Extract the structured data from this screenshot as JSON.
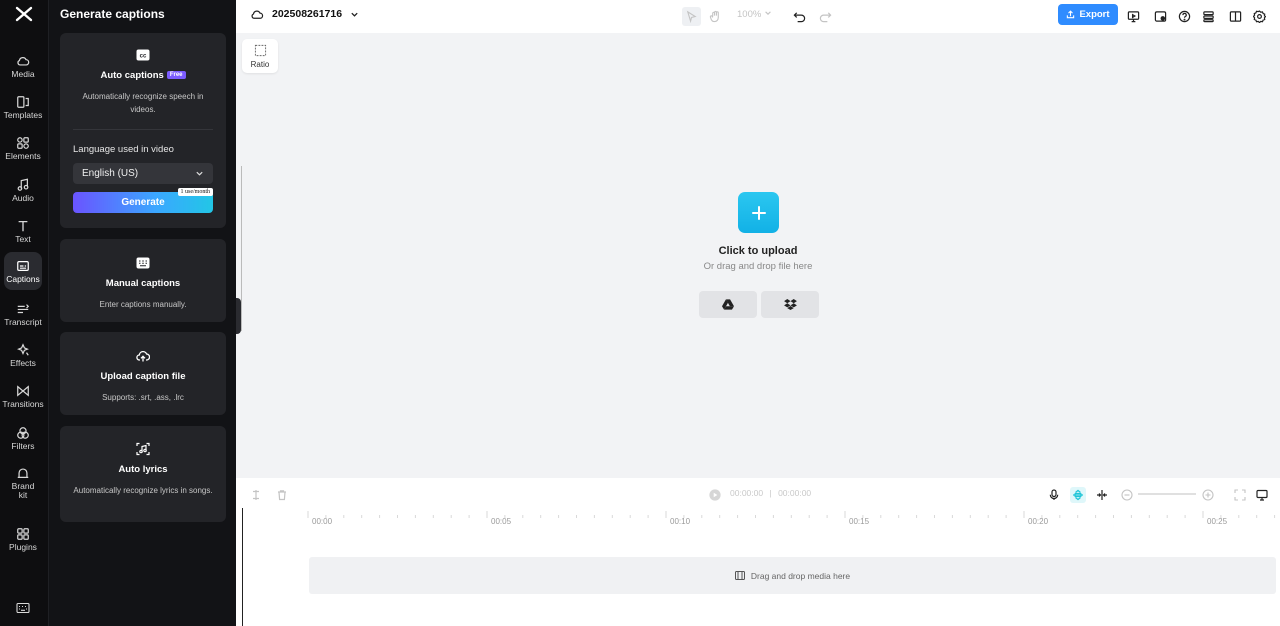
{
  "panel": {
    "title": "Generate captions",
    "auto_captions": {
      "title": "Auto captions",
      "badge": "Free",
      "description": "Automatically recognize speech in videos.",
      "language_label": "Language used in video",
      "language_value": "English (US)",
      "generate_label": "Generate",
      "quota_tag": "1 use/month"
    },
    "manual_captions": {
      "title": "Manual captions",
      "description": "Enter captions manually."
    },
    "upload_caption_file": {
      "title": "Upload caption file",
      "description": "Supports: .srt, .ass, .lrc"
    },
    "auto_lyrics": {
      "title": "Auto lyrics",
      "description": "Automatically recognize lyrics in songs."
    }
  },
  "rail": {
    "items": [
      {
        "label": "Media",
        "icon": "cloud-icon"
      },
      {
        "label": "Templates",
        "icon": "templates-icon"
      },
      {
        "label": "Elements",
        "icon": "elements-icon"
      },
      {
        "label": "Audio",
        "icon": "music-note-icon"
      },
      {
        "label": "Text",
        "icon": "text-icon"
      },
      {
        "label": "Captions",
        "icon": "captions-icon",
        "active": true
      },
      {
        "label": "Transcript",
        "icon": "transcript-icon"
      },
      {
        "label": "Effects",
        "icon": "effects-icon"
      },
      {
        "label": "Transitions",
        "icon": "transitions-icon"
      },
      {
        "label": "Filters",
        "icon": "filters-icon"
      },
      {
        "label": "Brand kit",
        "icon": "brand-kit-icon"
      },
      {
        "label": "Plugins",
        "icon": "plugins-icon"
      }
    ]
  },
  "topbar": {
    "project_name": "202508261716",
    "zoom": "100%",
    "export_label": "Export"
  },
  "canvas": {
    "ratio_label": "Ratio",
    "upload_title": "Click to upload",
    "upload_subtitle": "Or drag and drop file here"
  },
  "timeline": {
    "current_time": "00:00:00",
    "separator": "|",
    "total_time": "00:00:00",
    "ticks": [
      "00:00",
      "00:05",
      "00:10",
      "00:15",
      "00:20",
      "00:25"
    ],
    "drop_text": "Drag and drop media here"
  },
  "colors": {
    "accent": "#2f8cff",
    "upload": "#12b1e6",
    "active_tool": "#20c5d8"
  }
}
